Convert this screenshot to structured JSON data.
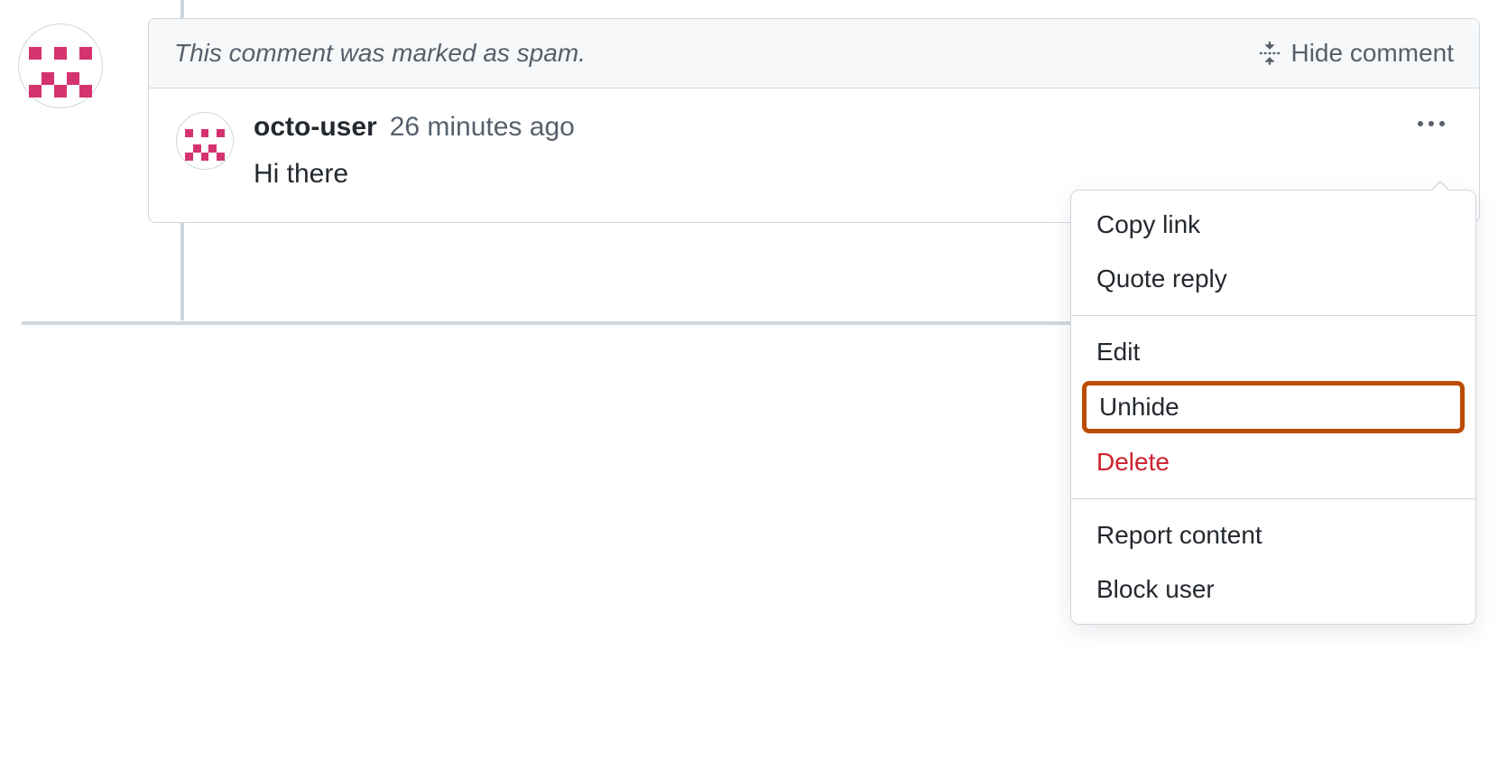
{
  "spam_banner": {
    "text": "This comment was marked as spam.",
    "hide_label": "Hide comment"
  },
  "comment": {
    "username": "octo-user",
    "timestamp": "26 minutes ago",
    "body": "Hi there"
  },
  "menu": {
    "copy_link": "Copy link",
    "quote_reply": "Quote reply",
    "edit": "Edit",
    "unhide": "Unhide",
    "delete": "Delete",
    "report_content": "Report content",
    "block_user": "Block user"
  },
  "identicon_pattern": [
    0,
    0,
    0,
    0,
    0,
    1,
    0,
    1,
    0,
    1,
    0,
    0,
    0,
    0,
    0,
    0,
    1,
    0,
    1,
    0,
    1,
    0,
    1,
    0,
    1
  ]
}
